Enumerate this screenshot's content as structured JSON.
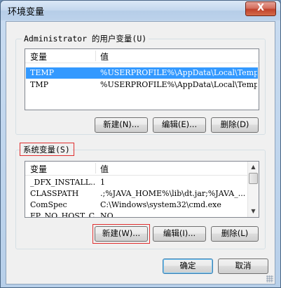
{
  "window": {
    "title": "环境变量",
    "close_label": "X"
  },
  "user_vars": {
    "legend": "Administrator 的用户变量(U)",
    "columns": [
      "变量",
      "值"
    ],
    "rows": [
      {
        "name": "TEMP",
        "value": "%USERPROFILE%\\AppData\\Local\\Temp",
        "selected": true
      },
      {
        "name": "TMP",
        "value": "%USERPROFILE%\\AppData\\Local\\Temp",
        "selected": false
      }
    ],
    "buttons": {
      "new": "新建(N)...",
      "edit": "编辑(E)...",
      "delete": "删除(D)"
    }
  },
  "system_vars": {
    "legend": "系统变量(S)",
    "columns": [
      "变量",
      "值"
    ],
    "rows": [
      {
        "name": "_DFX_INSTALL...",
        "value": "1"
      },
      {
        "name": "CLASSPATH",
        "value": ".;%JAVA_HOME%\\lib\\dt.jar;%JAVA_..."
      },
      {
        "name": "ComSpec",
        "value": "C:\\Windows\\system32\\cmd.exe"
      },
      {
        "name": "FP_NO_HOST_C...",
        "value": "NO"
      }
    ],
    "buttons": {
      "new": "新建(W)...",
      "edit": "编辑(I)...",
      "delete": "删除(L)"
    }
  },
  "footer": {
    "ok": "确定",
    "cancel": "取消"
  },
  "colors": {
    "selection": "#3399ff",
    "highlight_box": "#e03030"
  }
}
